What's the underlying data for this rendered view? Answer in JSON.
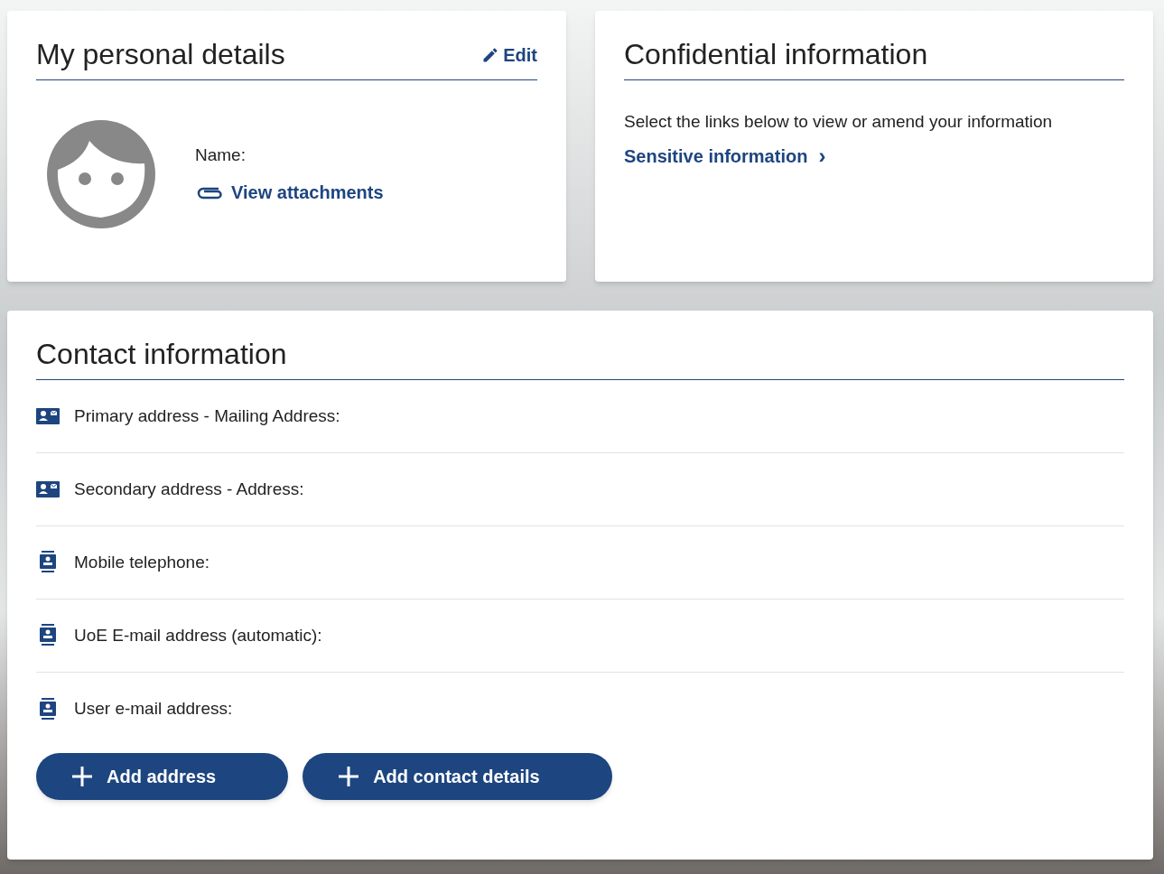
{
  "personal_details": {
    "title": "My personal details",
    "edit_link": "Edit",
    "name_label": "Name:",
    "attachments_link": "View attachments"
  },
  "confidential": {
    "title": "Confidential information",
    "description": "Select the links below to view or amend your information",
    "link": "Sensitive information",
    "link_chevron": "›"
  },
  "contact": {
    "title": "Contact information",
    "rows": [
      {
        "kind": "address",
        "label": "Primary address - Mailing Address:"
      },
      {
        "kind": "address",
        "label": "Secondary address - Address:"
      },
      {
        "kind": "contact",
        "label": "Mobile telephone:"
      },
      {
        "kind": "contact",
        "label": "UoE E-mail address (automatic):"
      },
      {
        "kind": "contact",
        "label": "User e-mail address:"
      }
    ],
    "buttons": [
      {
        "label": "Add address"
      },
      {
        "label": "Add contact details"
      }
    ]
  }
}
